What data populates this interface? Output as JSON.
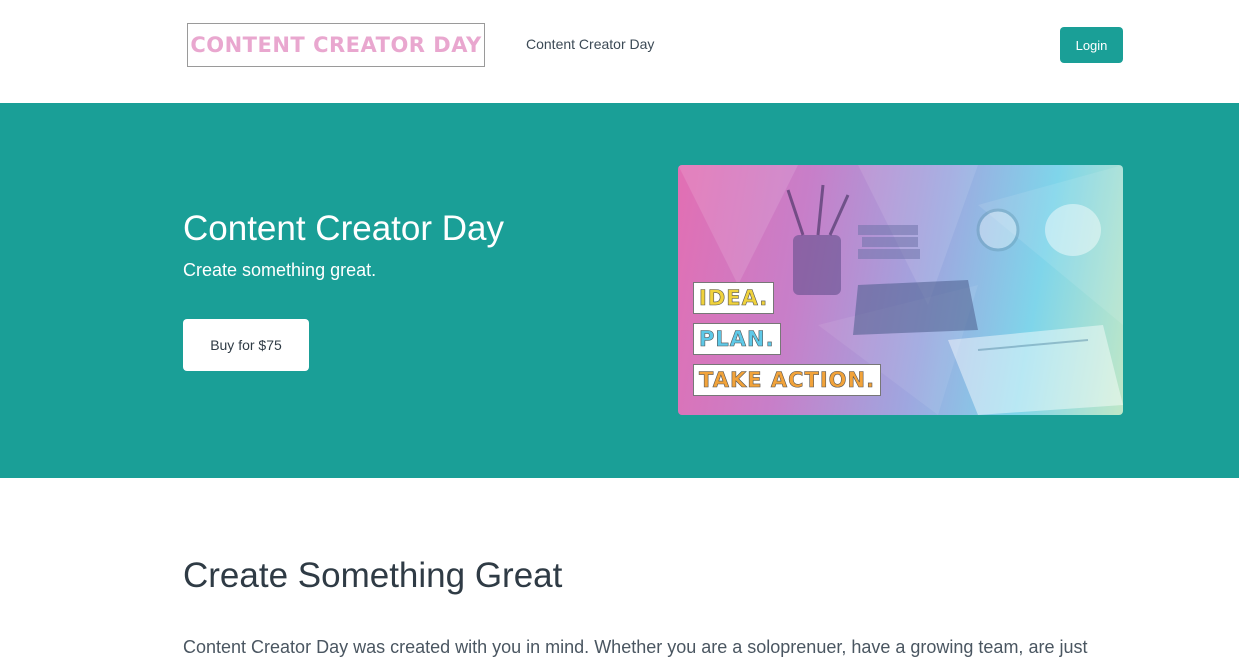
{
  "header": {
    "logo_text": "CONTENT CREATOR DAY",
    "site_name": "Content Creator Day",
    "login_label": "Login"
  },
  "hero": {
    "title": "Content Creator Day",
    "subtitle": "Create something great.",
    "buy_label": "Buy for $75",
    "image_tags": [
      "IDEA.",
      "PLAN.",
      "TAKE ACTION."
    ]
  },
  "content": {
    "heading": "Create Something Great",
    "paragraph": "Content Creator Day was created with you in mind. Whether you are a soloprenuer, have a growing team, are just"
  },
  "colors": {
    "brand_teal": "#1a9f97",
    "text_dark": "#2f3b45",
    "white": "#ffffff"
  }
}
